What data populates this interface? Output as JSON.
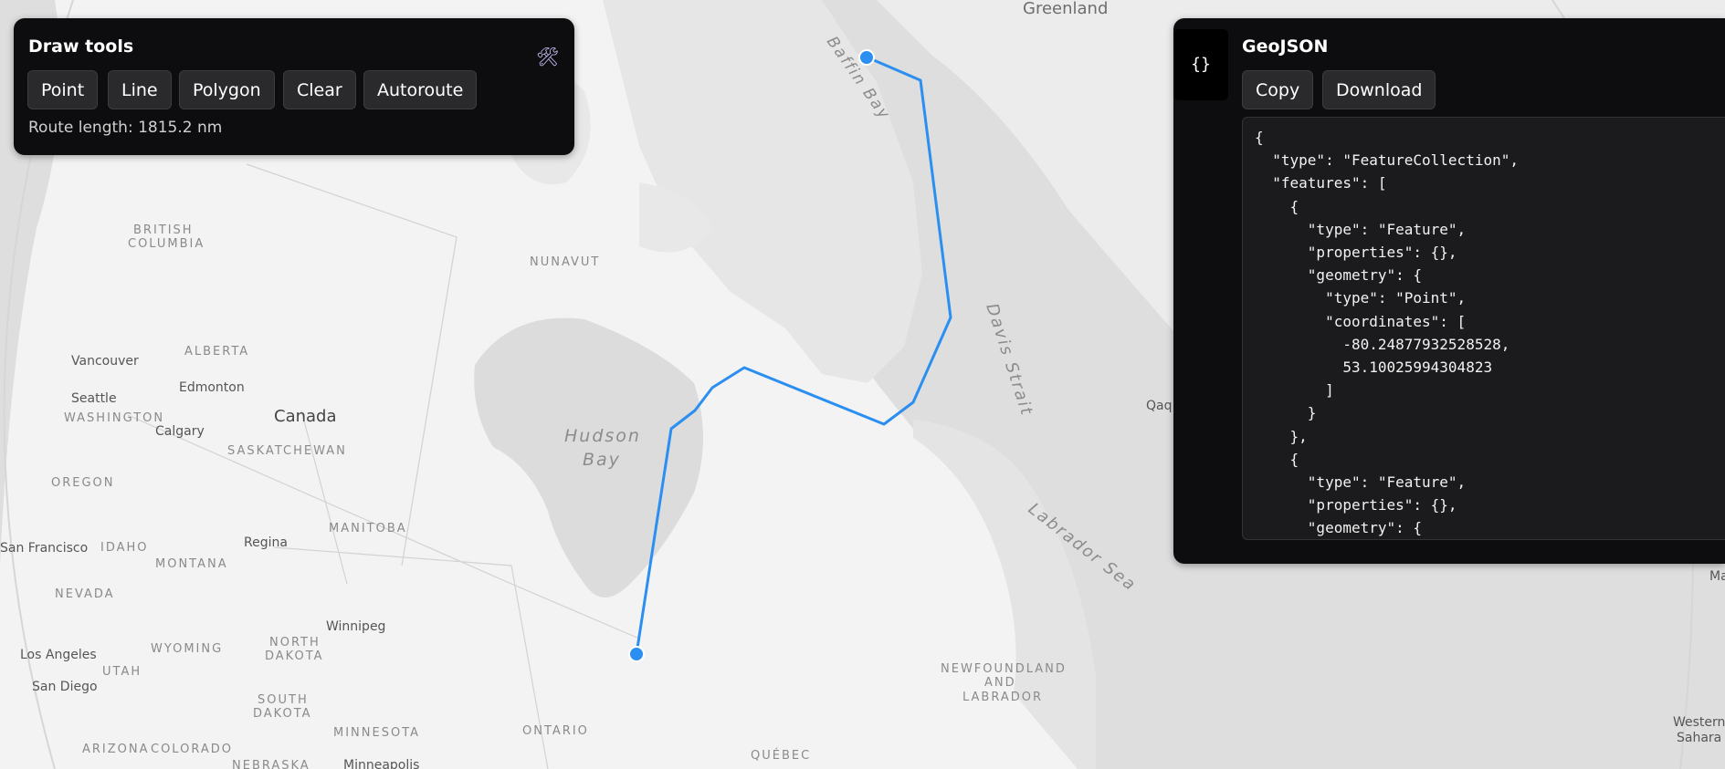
{
  "map": {
    "labels": {
      "greenland": "Greenland",
      "baffin_bay": "Baffin Bay",
      "davis_strait": "Davis Strait",
      "labrador_sea": "Labrador Sea",
      "hudson_1": "Hudson",
      "hudson_2": "Bay",
      "canada": "Canada",
      "nunavut": "NUNAVUT",
      "british_columbia_1": "BRITISH",
      "british_columbia_2": "COLUMBIA",
      "alberta": "ALBERTA",
      "saskatchewan": "SASKATCHEWAN",
      "manitoba": "MANITOBA",
      "ontario": "ONTARIO",
      "quebec": "QUÉBEC",
      "nfl_1": "NEWFOUNDLAND",
      "nfl_2": "AND",
      "nfl_3": "LABRADOR",
      "washington": "WASHINGTON",
      "oregon": "OREGON",
      "idaho": "IDAHO",
      "montana": "MONTANA",
      "nevada": "NEVADA",
      "wyoming": "WYOMING",
      "utah": "UTAH",
      "arizona": "ARIZONA",
      "colorado": "COLORADO",
      "north_dakota_1": "NORTH",
      "north_dakota_2": "DAKOTA",
      "south_dakota_1": "SOUTH",
      "south_dakota_2": "DAKOTA",
      "minnesota": "MINNESOTA",
      "nebraska": "NEBRASKA",
      "vancouver": "Vancouver",
      "seattle": "Seattle",
      "edmonton": "Edmonton",
      "calgary": "Calgary",
      "regina": "Regina",
      "winnipeg": "Winnipeg",
      "san_francisco": "San Francisco",
      "los_angeles": "Los Angeles",
      "san_diego": "San Diego",
      "minneapolis": "Minneapolis",
      "qaq": "Qaq",
      "ma": "Ma",
      "western_sahara_1": "Western",
      "western_sahara_2": "Sahara"
    },
    "route_color": "#2a8ff0"
  },
  "draw_tools": {
    "title": "Draw tools",
    "icon": "tools-icon",
    "buttons": {
      "point": "Point",
      "line": "Line",
      "polygon": "Polygon",
      "clear": "Clear",
      "autoroute": "Autoroute"
    },
    "route_length": "Route length: 1815.2 nm"
  },
  "geojson": {
    "icon_text": "{}",
    "title": "GeoJSON",
    "copy_label": "Copy",
    "download_label": "Download",
    "content": "{\n  \"type\": \"FeatureCollection\",\n  \"features\": [\n    {\n      \"type\": \"Feature\",\n      \"properties\": {},\n      \"geometry\": {\n        \"type\": \"Point\",\n        \"coordinates\": [\n          -80.24877932528528,\n          53.10025994304823\n        ]\n      }\n    },\n    {\n      \"type\": \"Feature\",\n      \"properties\": {},\n      \"geometry\": {"
  }
}
